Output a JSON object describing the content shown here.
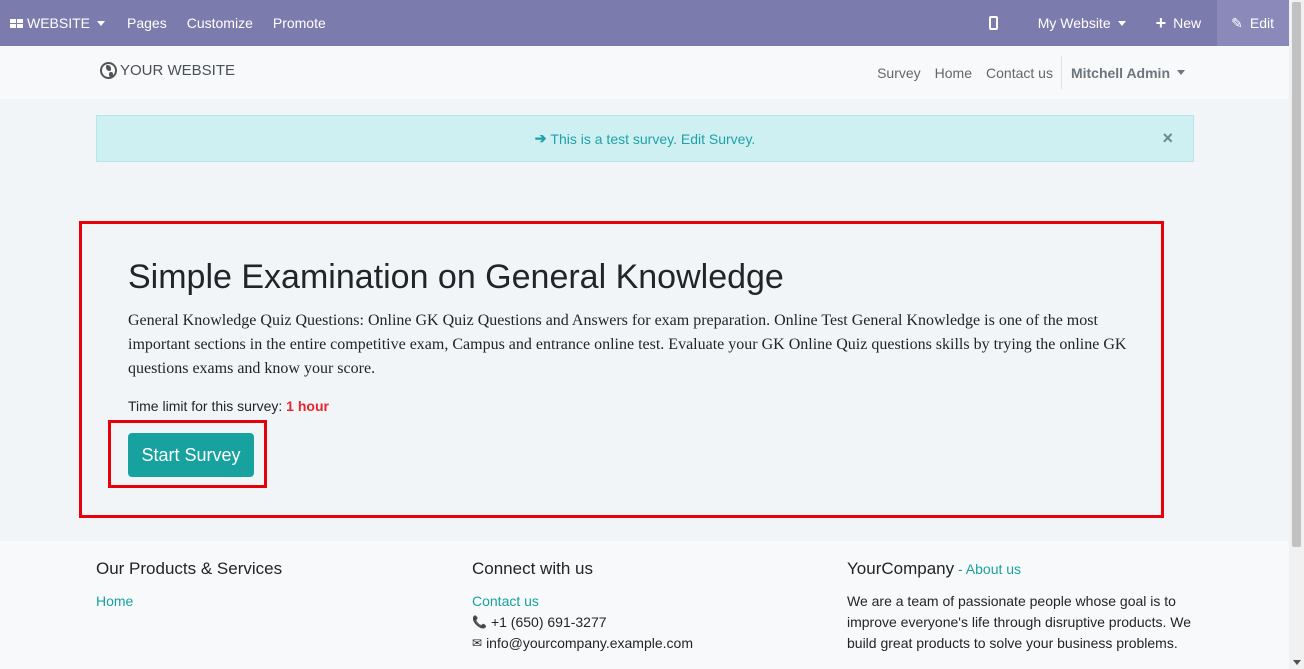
{
  "admin_bar": {
    "brand": "WEBSITE",
    "menu": [
      "Pages",
      "Customize",
      "Promote"
    ],
    "website_selector": "My Website",
    "new_label": "New",
    "edit_label": "Edit"
  },
  "header": {
    "logo_text": "YOUR WEBSITE",
    "nav": [
      "Survey",
      "Home",
      "Contact us"
    ],
    "user": "Mitchell Admin"
  },
  "alert": {
    "text": "This is a test survey. Edit Survey.",
    "close": "×"
  },
  "survey": {
    "title": "Simple Examination on General Knowledge",
    "description": "General Knowledge Quiz Questions: Online GK Quiz Questions and Answers for exam preparation. Online Test General Knowledge is one of the most important sections in the entire competitive exam, Campus and entrance online test. Evaluate your GK Online Quiz questions skills by trying the online GK questions exams and know your score.",
    "time_limit_label": "Time limit for this survey:",
    "time_limit_value": "1 hour",
    "start_label": "Start Survey"
  },
  "footer": {
    "col1": {
      "title": "Our Products & Services",
      "links": [
        "Home"
      ]
    },
    "col2": {
      "title": "Connect with us",
      "contact": "Contact us",
      "phone": "+1 (650) 691-3277",
      "email": "info@yourcompany.example.com"
    },
    "col3": {
      "title": "YourCompany",
      "sep": " - ",
      "about": "About us",
      "text": "We are a team of passionate people whose goal is to improve everyone's life through disruptive products. We build great products to solve your business problems."
    }
  },
  "colors": {
    "admin_bar": "#7c7bad",
    "accent": "#17a2a0",
    "highlight_border": "#e8000b",
    "alert_bg": "#cff0f2"
  }
}
